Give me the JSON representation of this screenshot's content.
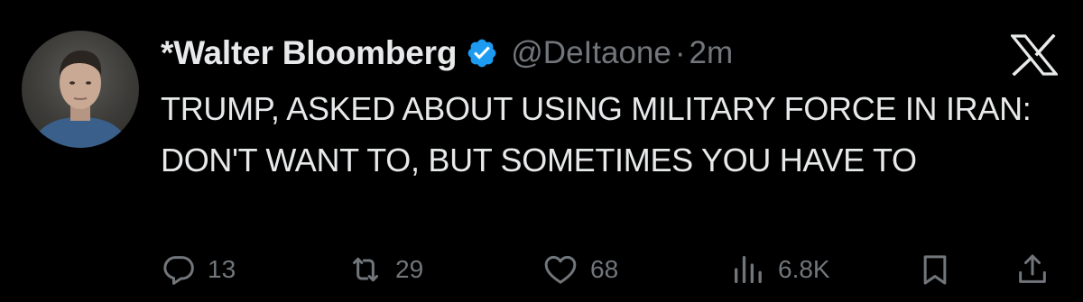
{
  "author": {
    "display_name": "*Walter Bloomberg",
    "handle": "@DeItaone",
    "separator": "·",
    "time": "2m",
    "verified": true
  },
  "tweet": {
    "text": "TRUMP, ASKED ABOUT USING MILITARY FORCE IN IRAN: DON'T WANT TO, BUT SOMETIMES YOU HAVE TO"
  },
  "actions": {
    "replies": "13",
    "reposts": "29",
    "likes": "68",
    "views": "6.8K"
  },
  "colors": {
    "background": "#000000",
    "text_primary": "#e7e9ea",
    "text_secondary": "#71767b",
    "verified_badge": "#1d9bf0"
  },
  "icons": {
    "brand": "x-logo-icon",
    "verified": "verified-badge-icon",
    "reply": "reply-icon",
    "repost": "repost-icon",
    "like": "like-icon",
    "views": "views-icon",
    "bookmark": "bookmark-icon",
    "share": "share-icon"
  }
}
